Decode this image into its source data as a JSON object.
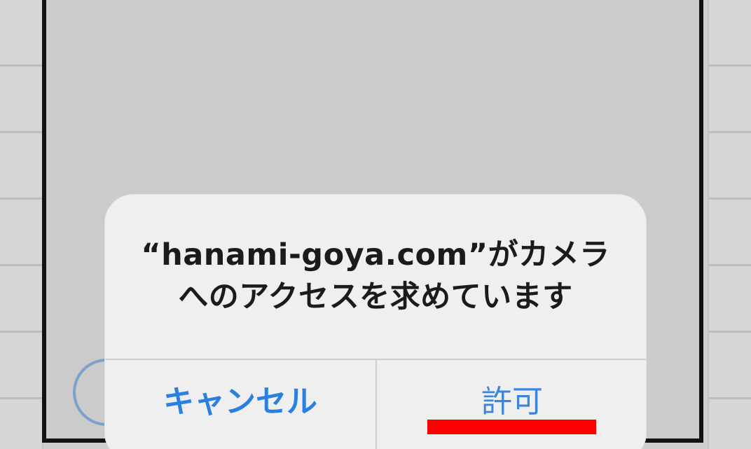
{
  "dialog": {
    "message_line1": "“hanami-goya.com”がカメラ",
    "message_line2": "へのアクセスを求めています",
    "cancel_label": "キャンセル",
    "allow_label": "許可"
  },
  "colors": {
    "button_text": "#2a7fe0",
    "highlight": "#ff0000",
    "dialog_bg": "#efefef",
    "frame": "#111111"
  },
  "icons": {
    "background_control": "circle-outline-icon"
  }
}
